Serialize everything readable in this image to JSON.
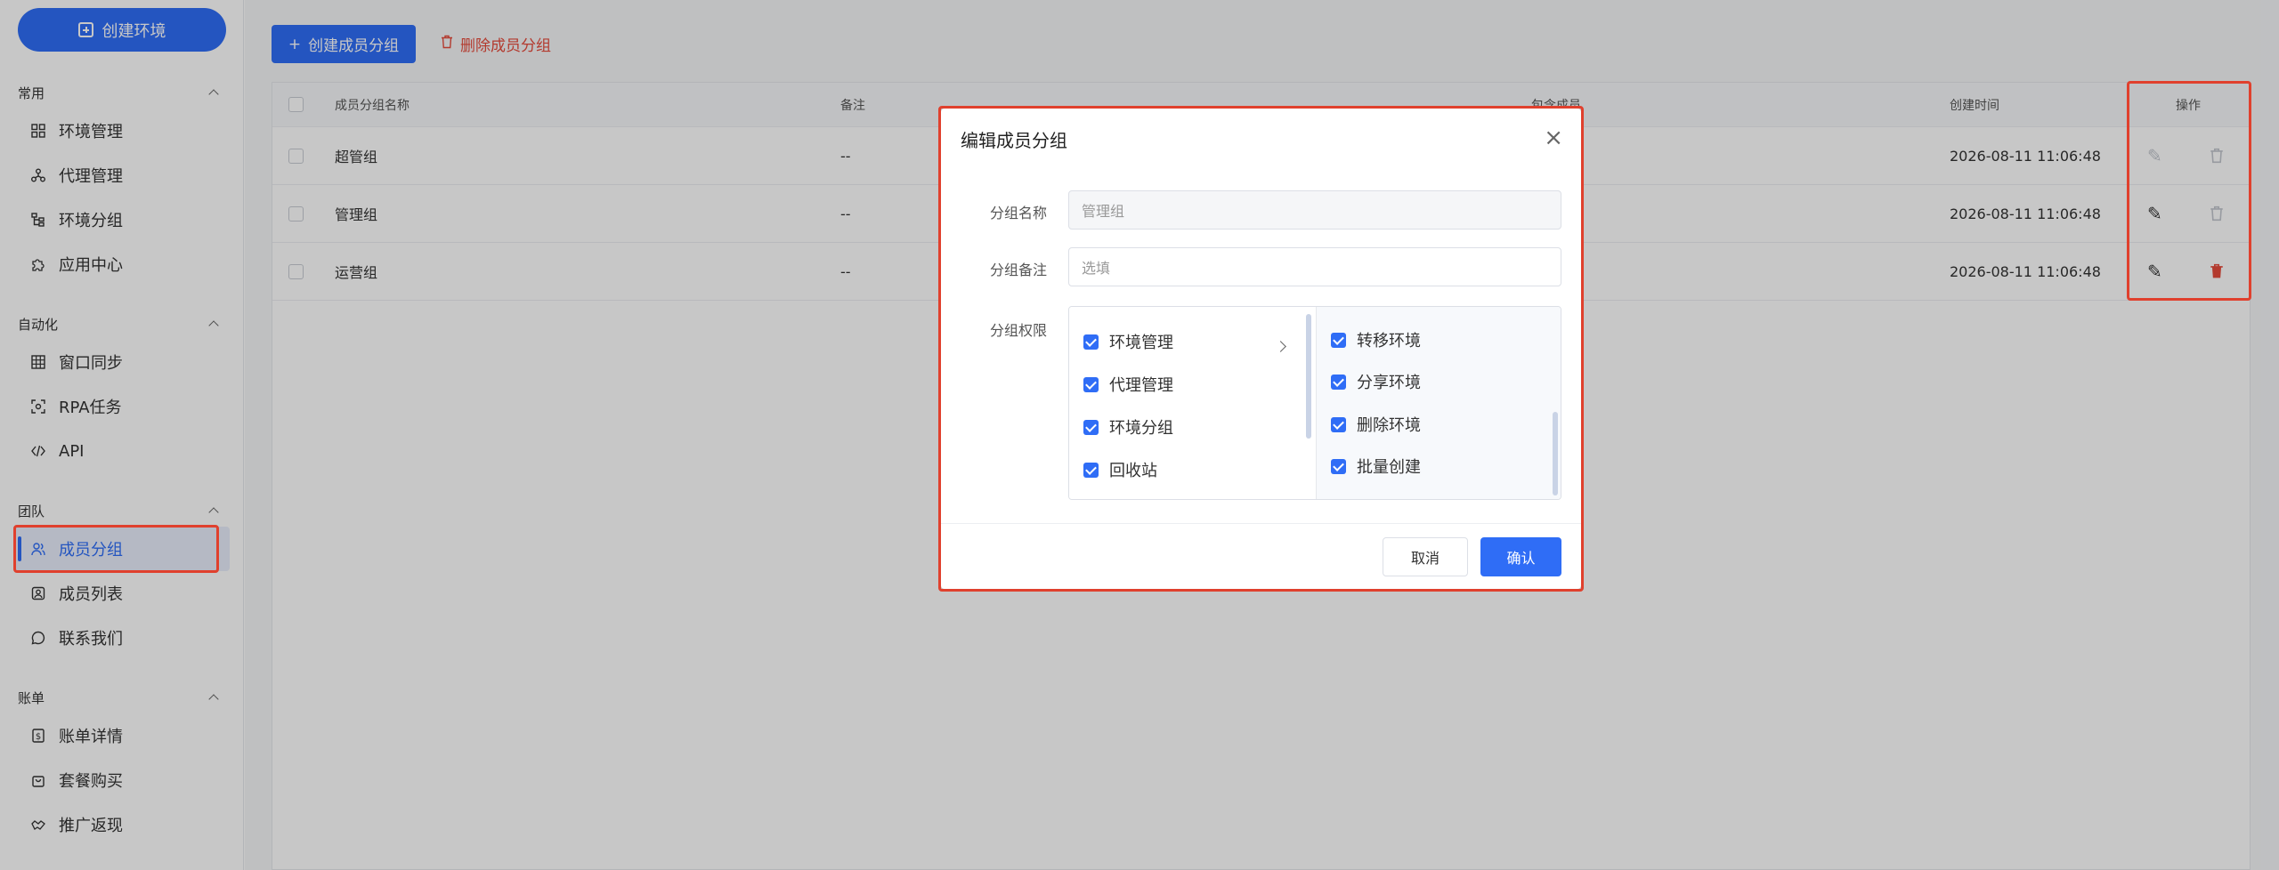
{
  "sidebar": {
    "create_button": "创建环境",
    "sections": [
      {
        "title": "常用",
        "items": [
          "环境管理",
          "代理管理",
          "环境分组",
          "应用中心"
        ]
      },
      {
        "title": "自动化",
        "items": [
          "窗口同步",
          "RPA任务",
          "API"
        ]
      },
      {
        "title": "团队",
        "items": [
          "成员分组",
          "成员列表",
          "联系我们"
        ]
      },
      {
        "title": "账单",
        "items": [
          "账单详情",
          "套餐购买",
          "推广返现"
        ]
      }
    ],
    "active_item": "成员分组"
  },
  "toolbar": {
    "create_group": "创建成员分组",
    "delete_group": "删除成员分组"
  },
  "table": {
    "headers": {
      "name": "成员分组名称",
      "remark": "备注",
      "members": "包含成员",
      "created": "创建时间",
      "ops": "操作"
    },
    "rows": [
      {
        "name": "超管组",
        "remark": "--",
        "created": "2026-08-11 11:06:48"
      },
      {
        "name": "管理组",
        "remark": "--",
        "created": "2026-08-11 11:06:48"
      },
      {
        "name": "运营组",
        "remark": "--",
        "created": "2026-08-11 11:06:48"
      }
    ]
  },
  "modal": {
    "title": "编辑成员分组",
    "close": "×",
    "name_label": "分组名称",
    "name_placeholder": "管理组",
    "remark_label": "分组备注",
    "remark_placeholder": "选填",
    "perm_label": "分组权限",
    "perm_left": [
      "环境管理",
      "代理管理",
      "环境分组",
      "回收站"
    ],
    "perm_right": [
      "转移环境",
      "分享环境",
      "删除环境",
      "批量创建"
    ],
    "cancel": "取消",
    "confirm": "确认"
  }
}
